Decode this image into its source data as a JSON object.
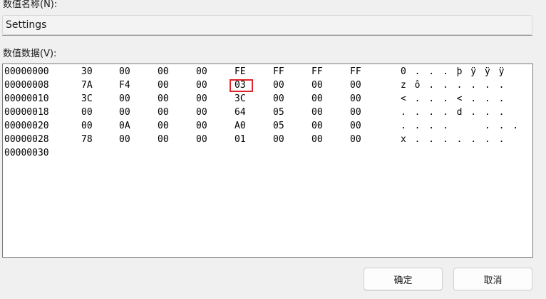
{
  "value_name": {
    "label": "数值名称(N):",
    "value": "Settings"
  },
  "value_data": {
    "label": "数值数据(V):",
    "rows": [
      {
        "offset": "00000000",
        "bytes": [
          "30",
          "00",
          "00",
          "00",
          "FE",
          "FF",
          "FF",
          "FF"
        ],
        "ascii": "0...þÿÿÿ"
      },
      {
        "offset": "00000008",
        "bytes": [
          "7A",
          "F4",
          "00",
          "00",
          "03",
          "00",
          "00",
          "00"
        ],
        "ascii": "zô......"
      },
      {
        "offset": "00000010",
        "bytes": [
          "3C",
          "00",
          "00",
          "00",
          "3C",
          "00",
          "00",
          "00"
        ],
        "ascii": "<...<..."
      },
      {
        "offset": "00000018",
        "bytes": [
          "00",
          "00",
          "00",
          "00",
          "64",
          "05",
          "00",
          "00"
        ],
        "ascii": "....d..."
      },
      {
        "offset": "00000020",
        "bytes": [
          "00",
          "0A",
          "00",
          "00",
          "A0",
          "05",
          "00",
          "00"
        ],
        "ascii": "....  ..."
      },
      {
        "offset": "00000028",
        "bytes": [
          "78",
          "00",
          "00",
          "00",
          "01",
          "00",
          "00",
          "00"
        ],
        "ascii": "x......."
      },
      {
        "offset": "00000030",
        "bytes": [],
        "ascii": ""
      }
    ],
    "selected_byte": {
      "row": 1,
      "col": 4,
      "value": "03"
    }
  },
  "buttons": {
    "ok": "确定",
    "cancel": "取消"
  },
  "colors": {
    "selection_border": "#e0242b",
    "background": "#f0f0f0"
  }
}
